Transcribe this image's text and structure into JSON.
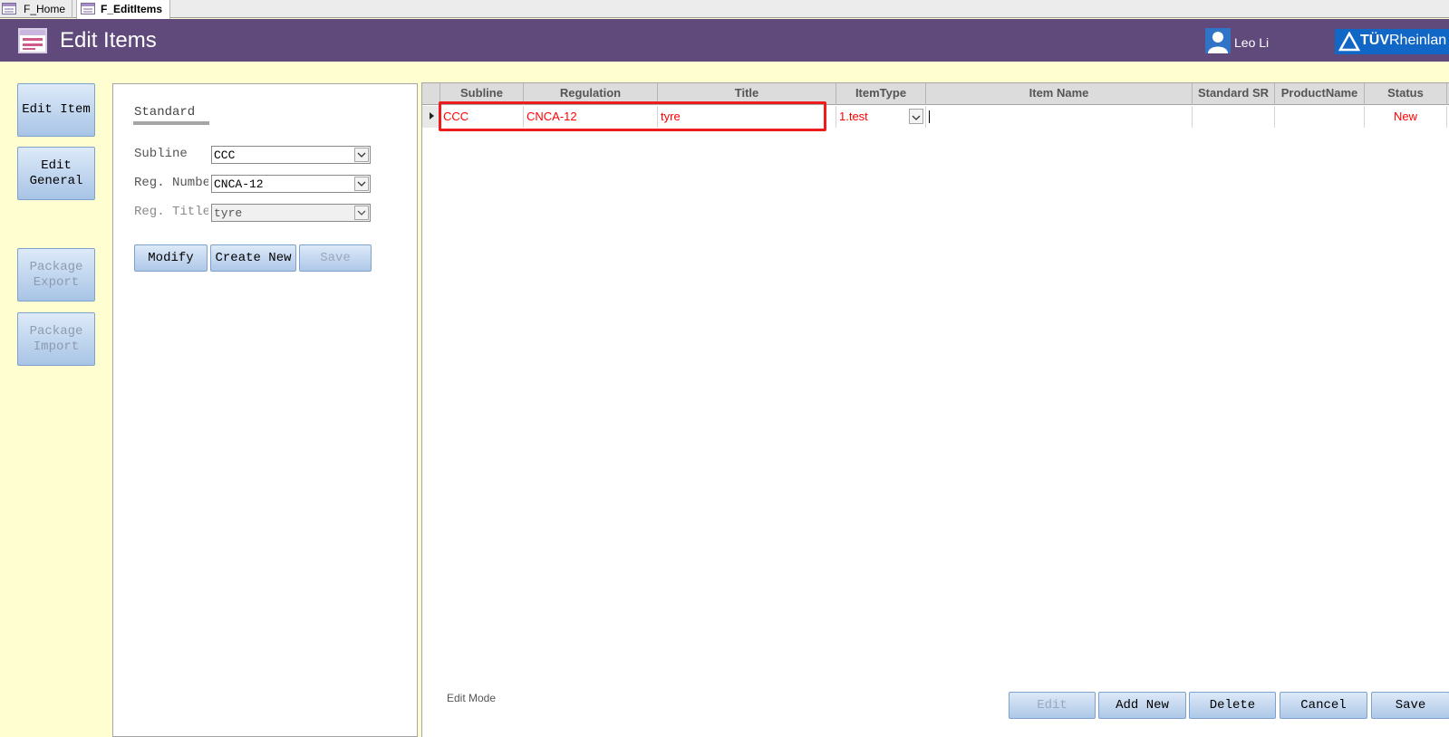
{
  "doc_tabs": [
    {
      "label": "F_Home"
    },
    {
      "label": "F_EditItems"
    }
  ],
  "header": {
    "title": "Edit Items",
    "user_name": "Leo Li",
    "logo_text_bold": "TÜV",
    "logo_text": "Rheinlan"
  },
  "nav": {
    "edit_item": "Edit Item",
    "edit_general_1": "Edit",
    "edit_general_2": "General",
    "package_export_1": "Package",
    "package_export_2": "Export",
    "package_import_1": "Package",
    "package_import_2": "Import"
  },
  "standard": {
    "title": "Standard",
    "subline_label": "Subline",
    "subline_value": "CCC",
    "reg_number_label": "Reg. Numbe",
    "reg_number_value": "CNCA-12",
    "reg_title_label": "Reg. Title",
    "reg_title_value": "tyre",
    "modify_label": "Modify",
    "create_new_label": "Create New",
    "save_label": "Save"
  },
  "grid": {
    "columns": [
      "Subline",
      "Regulation",
      "Title",
      "ItemType",
      "Item Name",
      "Standard SR",
      "ProductName",
      "Status"
    ],
    "row": {
      "subline": "CCC",
      "regulation": "CNCA-12",
      "title": "tyre",
      "item_type": "1.test",
      "item_name": "",
      "standard_sr": "",
      "product_name": "",
      "status": "New"
    }
  },
  "footer": {
    "mode_label": "Edit Mode",
    "edit_label": "Edit",
    "add_new_label": "Add New",
    "delete_label": "Delete",
    "cancel_label": "Cancel",
    "save_label": "Save"
  },
  "colors": {
    "header_bg": "#604a7b",
    "page_bg": "#fffed0",
    "accent_blue": "#1167c6",
    "row_text": "#ff0000",
    "highlight_border": "#ee1c1c"
  },
  "icons": [
    "form-icon",
    "user-icon",
    "tuv-logo-triangle-icon",
    "chevron-down-icon",
    "row-pointer-icon"
  ]
}
